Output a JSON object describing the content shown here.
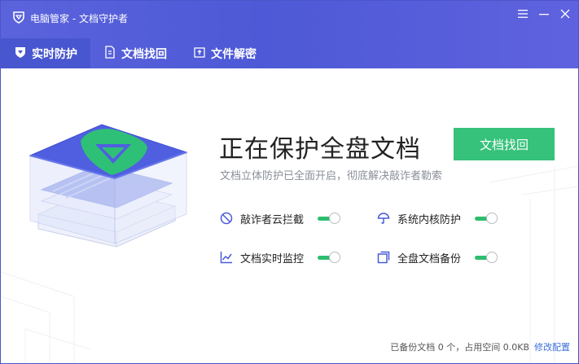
{
  "window": {
    "app_title": "电脑管家 - 文档守护者"
  },
  "tabs": [
    {
      "label": "实时防护",
      "icon": "shield-icon",
      "active": true
    },
    {
      "label": "文档找回",
      "icon": "document-restore-icon",
      "active": false
    },
    {
      "label": "文件解密",
      "icon": "file-decrypt-icon",
      "active": false
    }
  ],
  "main": {
    "heading": "正在保护全盘文档",
    "subtext": "文档立体防护已全面开启，彻底解决敲诈者勒索",
    "cta_label": "文档找回"
  },
  "features": [
    {
      "label": "敲诈者云拦截",
      "icon": "block-icon",
      "enabled": true
    },
    {
      "label": "系统内核防护",
      "icon": "umbrella-icon",
      "enabled": true
    },
    {
      "label": "文档实时监控",
      "icon": "line-chart-icon",
      "enabled": true
    },
    {
      "label": "全盘文档备份",
      "icon": "backup-icon",
      "enabled": true
    }
  ],
  "footer": {
    "status": "已备份文档 0 个，占用空间 0.0KB",
    "link": "修改配置"
  },
  "colors": {
    "header": "#5059d6",
    "active_tab": "#4856cf",
    "primary_button": "#36c27a",
    "toggle_on": "#2ebd6e",
    "link": "#3d6fdc"
  }
}
